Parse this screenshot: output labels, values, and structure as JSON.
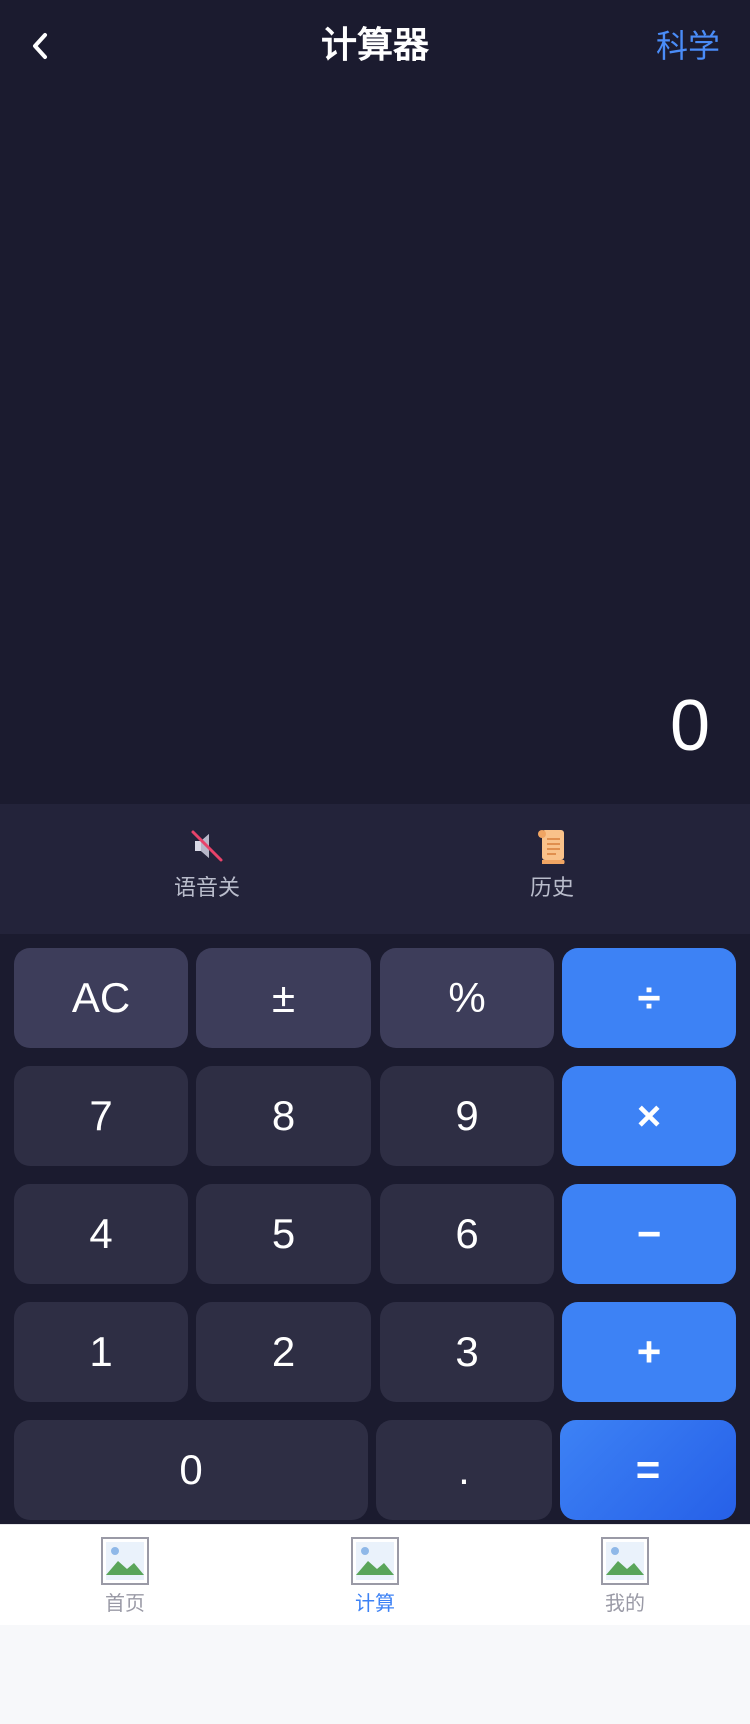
{
  "header": {
    "title": "计算器",
    "mode_label": "科学",
    "back_icon": "chevron-left-icon"
  },
  "display": {
    "value": "0"
  },
  "toolbar": {
    "voice": {
      "label": "语音关",
      "icon": "speaker-muted-icon"
    },
    "history": {
      "label": "历史",
      "icon": "scroll-icon"
    }
  },
  "keys": {
    "ac": "AC",
    "sign": "±",
    "percent": "%",
    "divide": "÷",
    "seven": "7",
    "eight": "8",
    "nine": "9",
    "multiply": "×",
    "four": "4",
    "five": "5",
    "six": "6",
    "subtract": "−",
    "one": "1",
    "two": "2",
    "three": "3",
    "add": "+",
    "zero": "0",
    "decimal": ".",
    "equals": "="
  },
  "tabbar": {
    "items": [
      {
        "label": "首页",
        "icon": "broken-image-icon",
        "active": false
      },
      {
        "label": "计算",
        "icon": "broken-image-icon",
        "active": true
      },
      {
        "label": "我的",
        "icon": "broken-image-icon",
        "active": false
      }
    ]
  },
  "colors": {
    "background": "#1b1b2f",
    "toolbar": "#23233a",
    "key": "#2e2e44",
    "function_key": "#3d3d5a",
    "operator_key": "#3d82f5",
    "accent": "#4a8cf7"
  }
}
